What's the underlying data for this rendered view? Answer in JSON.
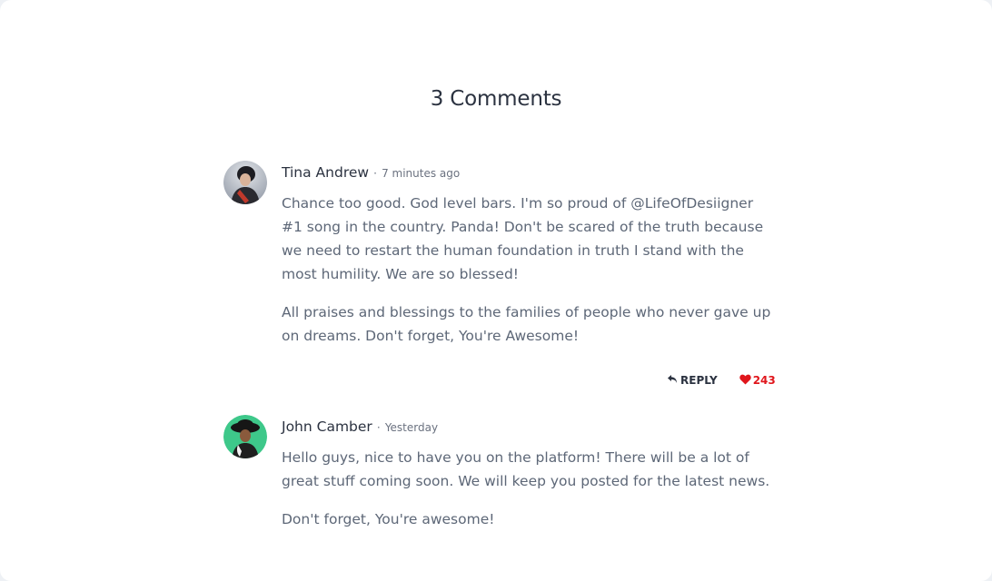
{
  "title": "3 Comments",
  "separator": "·",
  "comments": [
    {
      "author": "Tina Andrew",
      "time": "7 minutes ago",
      "paragraphs": [
        "Chance too good. God level bars. I'm so proud of @LifeOfDesiigner #1 song in the country. Panda! Don't be scared of the truth because we need to restart the human foundation in truth I stand with the most humility. We are so blessed!",
        "All praises and blessings to the families of people who never gave up on dreams. Don't forget, You're Awesome!"
      ],
      "reply_label": "REPLY",
      "likes": "243",
      "reply_icon": "reply-icon",
      "like_icon": "heart-icon",
      "avatar_bg": "#b9c0cc"
    },
    {
      "author": "John Camber",
      "time": "Yesterday",
      "paragraphs": [
        "Hello guys, nice to have you on the platform! There will be a lot of great stuff coming soon. We will keep you posted for the latest news.",
        "Don't forget, You're awesome!"
      ],
      "avatar_bg": "#3ec88a"
    }
  ],
  "colors": {
    "heading": "#2b3240",
    "body_text": "#5d6777",
    "like": "#e0161c"
  }
}
